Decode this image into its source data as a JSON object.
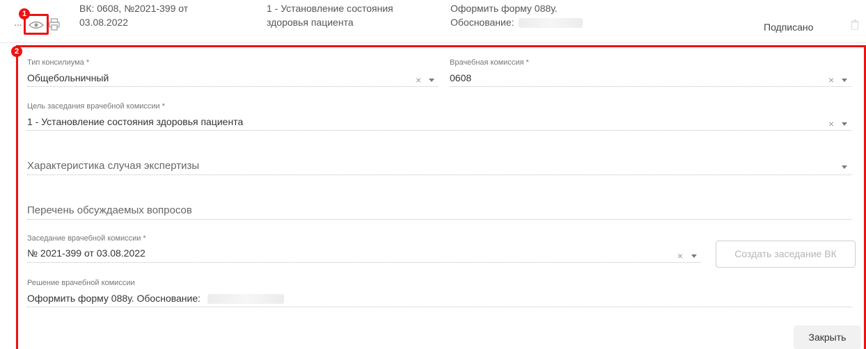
{
  "row": {
    "protocol_line1": "ВК: 0608, №2021-399 от",
    "protocol_line2": "03.08.2022",
    "purpose_line1": "1 - Установление состояния",
    "purpose_line2": "здоровья пациента",
    "decision_line1": "Оформить форму 088у.",
    "decision_line2": "Обоснование:",
    "status": "Подписано",
    "icons": [
      "more-dots-icon",
      "eye-icon",
      "printer-icon",
      "trash-icon"
    ]
  },
  "markers": {
    "one": "1",
    "two": "2"
  },
  "form": {
    "consilium_type": {
      "label": "Тип консилиума *",
      "value": "Общебольничный"
    },
    "commission": {
      "label": "Врачебная комиссия *",
      "value": "0608"
    },
    "goal": {
      "label": "Цель заседания врачебной комиссии *",
      "value": "1 - Установление состояния здоровья пациента"
    },
    "characteristic": {
      "placeholder": "Характеристика случая экспертизы"
    },
    "questions": {
      "placeholder": "Перечень обсуждаемых вопросов"
    },
    "session": {
      "label": "Заседание врачебной комиссии *",
      "value": "№ 2021-399 от 03.08.2022"
    },
    "decision": {
      "label": "Решение врачебной комиссии",
      "value": "Оформить форму 088у. Обоснование:"
    }
  },
  "buttons": {
    "create_session": "Создать заседание ВК",
    "close": "Закрыть",
    "clear": "×"
  },
  "colors": {
    "highlight": "#e11111",
    "disabled_text": "#b6b6b6"
  }
}
